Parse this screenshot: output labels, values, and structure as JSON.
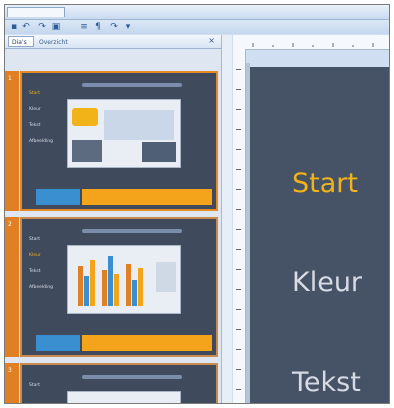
{
  "tabs": {
    "first": "",
    "second": ""
  },
  "panel": {
    "tab_slides": "Dia's",
    "tab_outline": "Overzicht"
  },
  "thumbnails": [
    {
      "number": "1",
      "menu": [
        "Start",
        "Kleur",
        "Tekst",
        "Afbeelding"
      ],
      "highlight_index": 0
    },
    {
      "number": "2",
      "menu": [
        "Start",
        "Kleur",
        "Tekst",
        "Afbeelding"
      ],
      "highlight_index": 1
    },
    {
      "number": "3",
      "menu": [
        "Start"
      ],
      "highlight_index": -1
    }
  ],
  "main_slide": {
    "items": [
      "Start",
      "Kleur",
      "Tekst"
    ],
    "highlight_color": "#f2b318",
    "normal_color": "#d7dbe4",
    "background": "#465266"
  },
  "accent_colors": {
    "orange": "#e07f23",
    "blue": "#3a8fd1",
    "yellow": "#f3a41a"
  }
}
